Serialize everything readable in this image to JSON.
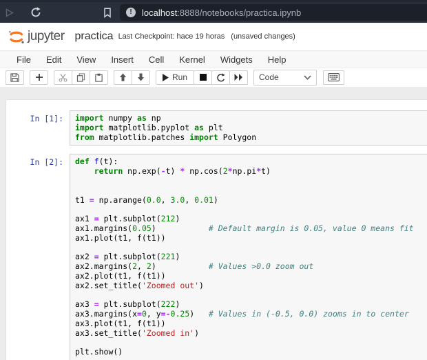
{
  "browser": {
    "url_host": "localhost",
    "url_path": ":8888/notebooks/practica.ipynb",
    "info_icon_glyph": "!"
  },
  "header": {
    "logo_text": "jupyter",
    "title": "practica",
    "checkpoint": "Last Checkpoint: hace 19 horas",
    "unsaved": "(unsaved changes)"
  },
  "menu": {
    "items": [
      "File",
      "Edit",
      "View",
      "Insert",
      "Cell",
      "Kernel",
      "Widgets",
      "Help"
    ]
  },
  "toolbar": {
    "run_label": "Run",
    "cell_type_value": "Code",
    "icons": [
      "save-icon",
      "add-cell-icon",
      "cut-cell-icon",
      "copy-cell-icon",
      "paste-cell-icon",
      "move-up-icon",
      "move-down-icon",
      "run-icon",
      "stop-icon",
      "restart-kernel-icon",
      "restart-run-all-icon",
      "keyboard-icon"
    ]
  },
  "colors": {
    "brand_orange": "#F37726",
    "prompt_blue": "#303F9F",
    "keyword_green": "#008000",
    "operator_purple": "#AA22FF",
    "comment_teal": "#408080",
    "string_red": "#BA2121",
    "chrome_dark": "#2a303b",
    "urlbar_dark": "#1b2029"
  },
  "cells": [
    {
      "prompt": "In [1]:",
      "lines": [
        [
          [
            "kw",
            "import"
          ],
          [
            "pl",
            " numpy "
          ],
          [
            "kw",
            "as"
          ],
          [
            "pl",
            " np"
          ]
        ],
        [
          [
            "kw",
            "import"
          ],
          [
            "pl",
            " matplotlib.pyplot "
          ],
          [
            "kw",
            "as"
          ],
          [
            "pl",
            " plt"
          ]
        ],
        [
          [
            "kw",
            "from"
          ],
          [
            "pl",
            " matplotlib.patches "
          ],
          [
            "kw",
            "import"
          ],
          [
            "pl",
            " Polygon"
          ]
        ]
      ]
    },
    {
      "prompt": "In [2]:",
      "lines": [
        [
          [
            "kw",
            "def"
          ],
          [
            "pl",
            " "
          ],
          [
            "fn",
            "f"
          ],
          [
            "pl",
            "(t):"
          ]
        ],
        [
          [
            "pl",
            "    "
          ],
          [
            "kw",
            "return"
          ],
          [
            "pl",
            " np.exp("
          ],
          [
            "op",
            "-"
          ],
          [
            "pl",
            "t) "
          ],
          [
            "op",
            "*"
          ],
          [
            "pl",
            " np.cos("
          ],
          [
            "num",
            "2"
          ],
          [
            "op",
            "*"
          ],
          [
            "pl",
            "np.pi"
          ],
          [
            "op",
            "*"
          ],
          [
            "pl",
            "t)"
          ]
        ],
        [],
        [],
        [
          [
            "pl",
            "t1 "
          ],
          [
            "op",
            "="
          ],
          [
            "pl",
            " np.arange("
          ],
          [
            "num",
            "0.0"
          ],
          [
            "pl",
            ", "
          ],
          [
            "num",
            "3.0"
          ],
          [
            "pl",
            ", "
          ],
          [
            "num",
            "0.01"
          ],
          [
            "pl",
            ")"
          ]
        ],
        [],
        [
          [
            "pl",
            "ax1 "
          ],
          [
            "op",
            "="
          ],
          [
            "pl",
            " plt.subplot("
          ],
          [
            "num",
            "212"
          ],
          [
            "pl",
            ")"
          ]
        ],
        [
          [
            "pl",
            "ax1.margins("
          ],
          [
            "num",
            "0.05"
          ],
          [
            "pl",
            ")           "
          ],
          [
            "com",
            "# Default margin is 0.05, value 0 means fit"
          ]
        ],
        [
          [
            "pl",
            "ax1.plot(t1, f(t1))"
          ]
        ],
        [],
        [
          [
            "pl",
            "ax2 "
          ],
          [
            "op",
            "="
          ],
          [
            "pl",
            " plt.subplot("
          ],
          [
            "num",
            "221"
          ],
          [
            "pl",
            ")"
          ]
        ],
        [
          [
            "pl",
            "ax2.margins("
          ],
          [
            "num",
            "2"
          ],
          [
            "pl",
            ", "
          ],
          [
            "num",
            "2"
          ],
          [
            "pl",
            ")           "
          ],
          [
            "com",
            "# Values >0.0 zoom out"
          ]
        ],
        [
          [
            "pl",
            "ax2.plot(t1, f(t1))"
          ]
        ],
        [
          [
            "pl",
            "ax2.set_title("
          ],
          [
            "str",
            "'Zoomed out'"
          ],
          [
            "pl",
            ")"
          ]
        ],
        [],
        [
          [
            "pl",
            "ax3 "
          ],
          [
            "op",
            "="
          ],
          [
            "pl",
            " plt.subplot("
          ],
          [
            "num",
            "222"
          ],
          [
            "pl",
            ")"
          ]
        ],
        [
          [
            "pl",
            "ax3.margins(x"
          ],
          [
            "op",
            "="
          ],
          [
            "num",
            "0"
          ],
          [
            "pl",
            ", y"
          ],
          [
            "op",
            "="
          ],
          [
            "op",
            "-"
          ],
          [
            "num",
            "0.25"
          ],
          [
            "pl",
            ")   "
          ],
          [
            "com",
            "# Values in (-0.5, 0.0) zooms in to center"
          ]
        ],
        [
          [
            "pl",
            "ax3.plot(t1, f(t1))"
          ]
        ],
        [
          [
            "pl",
            "ax3.set_title("
          ],
          [
            "str",
            "'Zoomed in'"
          ],
          [
            "pl",
            ")"
          ]
        ],
        [],
        [
          [
            "pl",
            "plt.show()"
          ]
        ]
      ]
    }
  ]
}
